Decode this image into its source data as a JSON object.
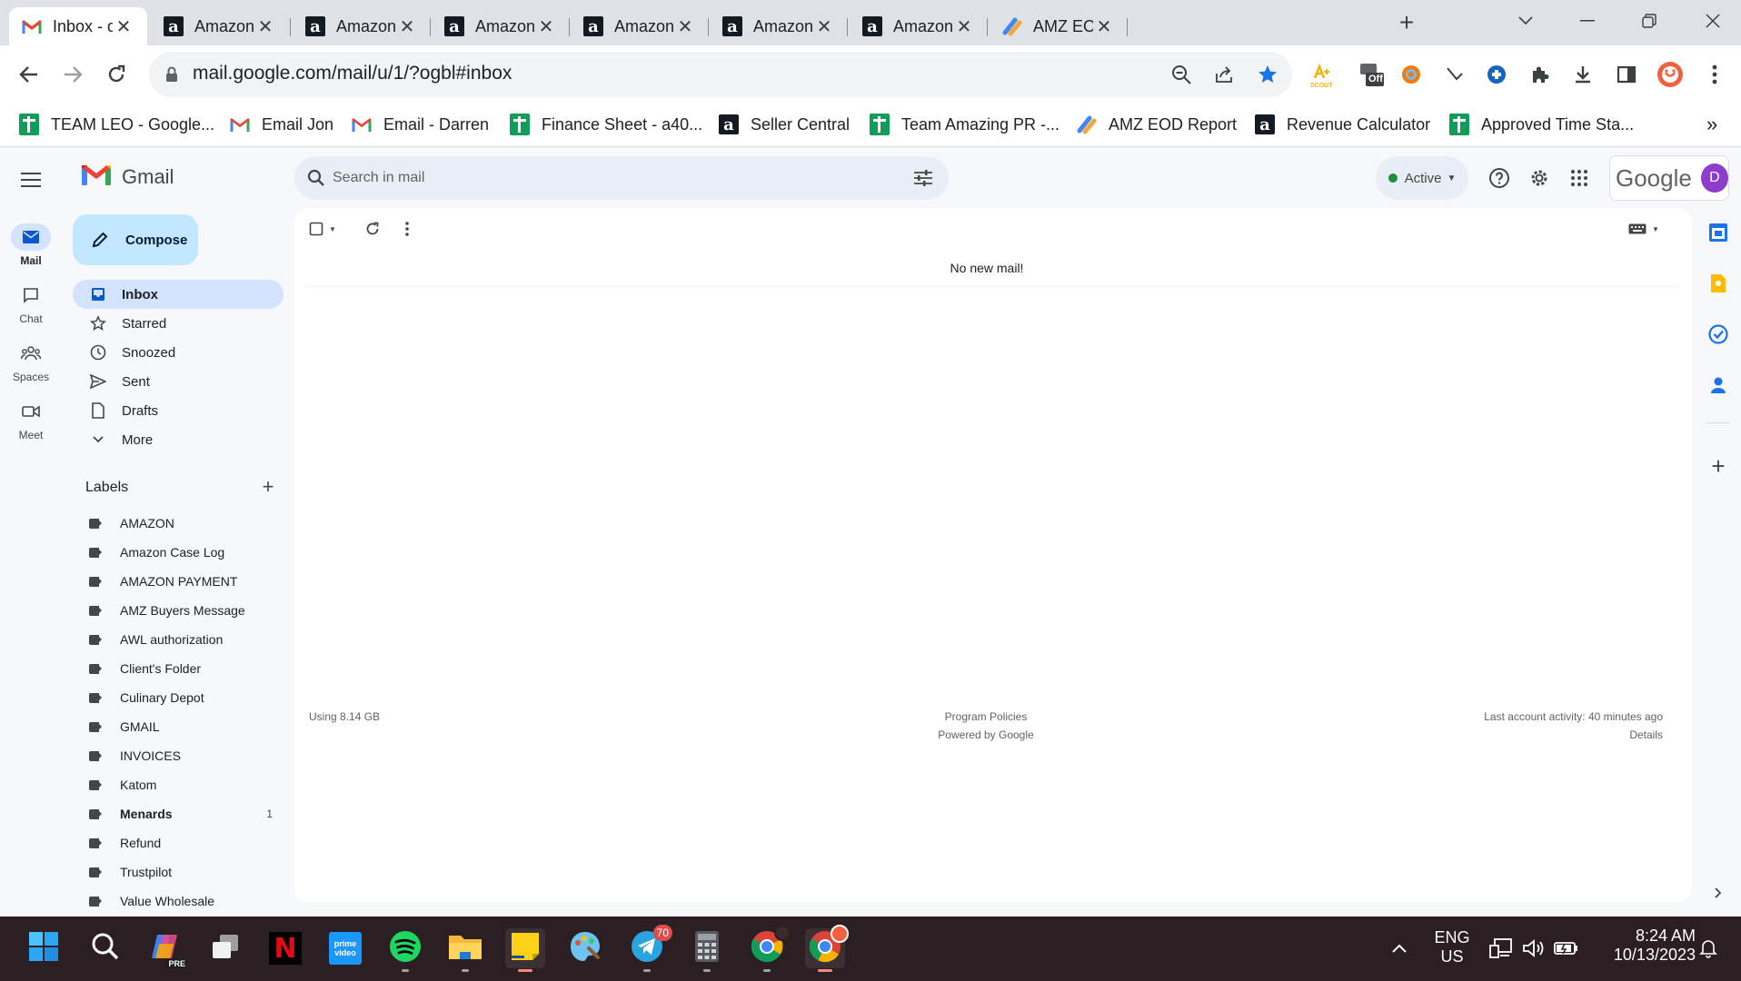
{
  "browser": {
    "tabs": [
      {
        "title": "Inbox - dar",
        "icon": "gmail-icon",
        "active": true
      },
      {
        "title": "Amazon",
        "icon": "amazon-icon"
      },
      {
        "title": "Amazon",
        "icon": "amazon-icon"
      },
      {
        "title": "Amazon",
        "icon": "amazon-icon"
      },
      {
        "title": "Amazon",
        "icon": "amazon-icon"
      },
      {
        "title": "Amazon",
        "icon": "amazon-icon"
      },
      {
        "title": "Amazon",
        "icon": "amazon-icon"
      },
      {
        "title": "AMZ EOD",
        "icon": "report-icon"
      }
    ],
    "url": "mail.google.com/mail/u/1/?ogbl#inbox",
    "extension_off_badge": "Off",
    "extension_scout_label": "SCOUT",
    "bookmarks": [
      {
        "label": "TEAM LEO - Google...",
        "icon": "sheets-icon"
      },
      {
        "label": "Email Jon",
        "icon": "gmail-icon"
      },
      {
        "label": "Email - Darren",
        "icon": "gmail-icon"
      },
      {
        "label": "Finance Sheet - a40...",
        "icon": "sheets-icon"
      },
      {
        "label": "Seller Central",
        "icon": "amazon-icon"
      },
      {
        "label": "Team Amazing PR -...",
        "icon": "sheets-icon"
      },
      {
        "label": "AMZ EOD Report",
        "icon": "report-icon"
      },
      {
        "label": "Revenue Calculator",
        "icon": "amazon-icon"
      },
      {
        "label": "Approved Time Sta...",
        "icon": "sheets-icon"
      }
    ],
    "bookmarks_overflow": "»"
  },
  "gmail": {
    "app_name": "Gmail",
    "search_placeholder": "Search in mail",
    "status": "Active",
    "google_wordmark": "Google",
    "avatar_letter": "D",
    "rail": [
      {
        "label": "Mail",
        "icon": "mail-icon",
        "active": true
      },
      {
        "label": "Chat",
        "icon": "chat-icon"
      },
      {
        "label": "Spaces",
        "icon": "spaces-icon"
      },
      {
        "label": "Meet",
        "icon": "meet-icon"
      }
    ],
    "compose": "Compose",
    "nav": [
      {
        "label": "Inbox",
        "icon": "inbox-icon",
        "active": true
      },
      {
        "label": "Starred",
        "icon": "star-icon"
      },
      {
        "label": "Snoozed",
        "icon": "clock-icon"
      },
      {
        "label": "Sent",
        "icon": "send-icon"
      },
      {
        "label": "Drafts",
        "icon": "draft-icon"
      },
      {
        "label": "More",
        "icon": "chevron-down-icon"
      }
    ],
    "labels_heading": "Labels",
    "labels": [
      {
        "name": "AMAZON"
      },
      {
        "name": "Amazon Case Log"
      },
      {
        "name": "AMAZON PAYMENT"
      },
      {
        "name": "AMZ Buyers Message"
      },
      {
        "name": "AWL authorization"
      },
      {
        "name": "Client's Folder"
      },
      {
        "name": "Culinary Depot"
      },
      {
        "name": "GMAIL"
      },
      {
        "name": "INVOICES"
      },
      {
        "name": "Katom"
      },
      {
        "name": "Menards",
        "count": "1",
        "bold": true
      },
      {
        "name": "Refund"
      },
      {
        "name": "Trustpilot"
      },
      {
        "name": "Value Wholesale"
      }
    ],
    "empty_message": "No new mail!",
    "footer": {
      "storage": "Using 8.14 GB",
      "policies": "Program Policies",
      "powered": "Powered by Google",
      "activity": "Last account activity: 40 minutes ago",
      "details": "Details"
    }
  },
  "taskbar": {
    "apps": [
      {
        "name": "start",
        "icon": "windows-icon"
      },
      {
        "name": "search",
        "icon": "search-icon"
      },
      {
        "name": "copilot",
        "icon": "copilot-icon",
        "badge_text": "PRE"
      },
      {
        "name": "task-view",
        "icon": "task-view-icon"
      },
      {
        "name": "netflix",
        "icon": "netflix-icon",
        "glyph": "N"
      },
      {
        "name": "prime-video",
        "icon": "prime-video-icon",
        "glyph": "prime video"
      },
      {
        "name": "spotify",
        "icon": "spotify-icon",
        "running": true
      },
      {
        "name": "file-explorer",
        "icon": "folder-icon",
        "running": true
      },
      {
        "name": "sticky-notes",
        "icon": "sticky-notes-icon",
        "running": true
      },
      {
        "name": "paint",
        "icon": "paint-icon"
      },
      {
        "name": "telegram",
        "icon": "telegram-icon",
        "badge": "70",
        "running": true
      },
      {
        "name": "calculator",
        "icon": "calculator-icon",
        "running": true
      },
      {
        "name": "chrome-1",
        "icon": "chrome-icon",
        "running": true
      },
      {
        "name": "chrome-2",
        "icon": "chrome-icon",
        "focused": true
      }
    ],
    "language": "ENG",
    "region": "US",
    "time": "8:24 AM",
    "date": "10/13/2023"
  },
  "colors": {
    "gmail_bg": "#f6f8fc",
    "compose_bg": "#c2e7ff",
    "active_nav_bg": "#d3e3fd",
    "taskbar_bg": "#2b1f24",
    "status_green": "#1e8e3e"
  }
}
